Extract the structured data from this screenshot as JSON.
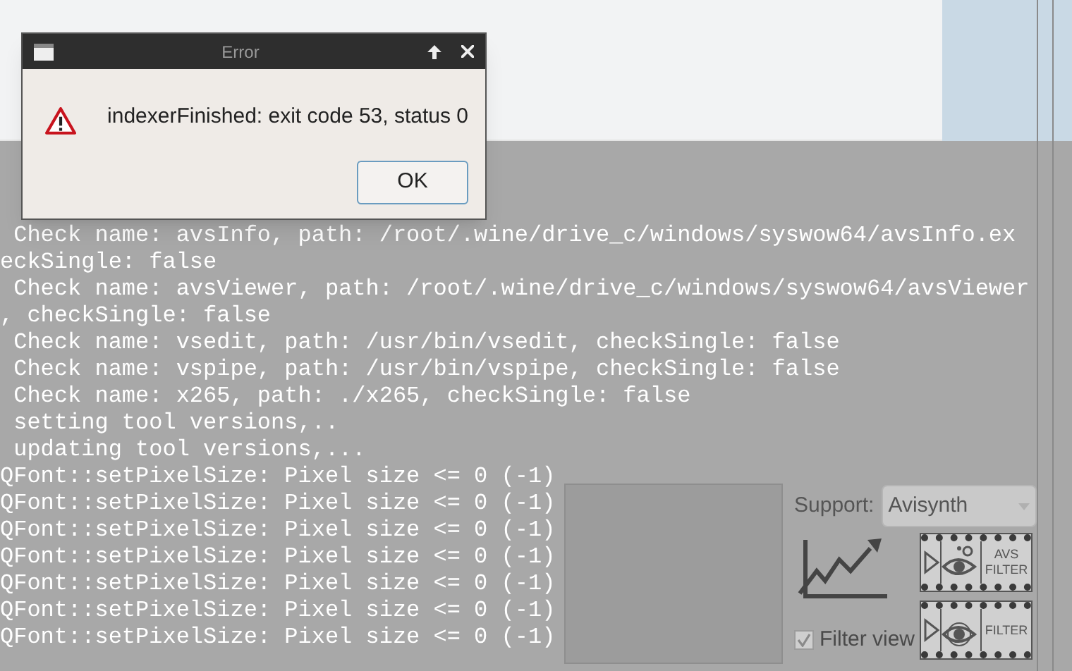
{
  "dialog": {
    "title": "Error",
    "message": "indexerFinished: exit code 53, status 0",
    "buttons": [
      "OK"
    ]
  },
  "log": {
    "lines": [
      " Check name: avsInfo, path: /root/.wine/drive_c/windows/syswow64/avsInfo.ex",
      "eckSingle: false",
      " Check name: avsViewer, path: /root/.wine/drive_c/windows/syswow64/avsViewer",
      ", checkSingle: false",
      " Check name: vsedit, path: /usr/bin/vsedit, checkSingle: false",
      " Check name: vspipe, path: /usr/bin/vspipe, checkSingle: false",
      " Check name: x265, path: ./x265, checkSingle: false",
      " setting tool versions,..",
      " updating tool versions,...",
      "QFont::setPixelSize: Pixel size <= 0 (-1)",
      "QFont::setPixelSize: Pixel size <= 0 (-1)",
      "QFont::setPixelSize: Pixel size <= 0 (-1)",
      "QFont::setPixelSize: Pixel size <= 0 (-1)",
      "QFont::setPixelSize: Pixel size <= 0 (-1)",
      "QFont::setPixelSize: Pixel size <= 0 (-1)",
      "QFont::setPixelSize: Pixel size <= 0 (-1)"
    ]
  },
  "panel": {
    "support_label": "Support:",
    "support_value": "Avisynth",
    "filter_view": {
      "label": "Filter view",
      "checked": true
    },
    "filter_buttons": [
      {
        "kind": "avs",
        "label": "AVS FILTER"
      },
      {
        "kind": "plain",
        "label": "FILTER"
      }
    ]
  }
}
